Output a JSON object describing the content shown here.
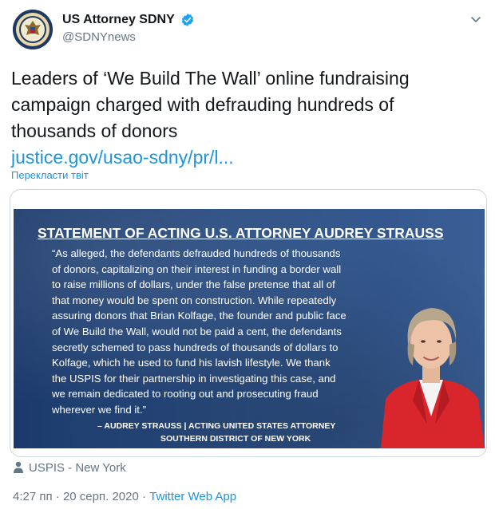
{
  "account": {
    "display_name": "US Attorney SDNY",
    "handle": "@SDNYnews",
    "verified": true
  },
  "tweet": {
    "text_lines": [
      "Leaders of ‘We Build The Wall’ online fundraising",
      "campaign charged with defrauding hundreds of",
      "thousands of donors"
    ],
    "link_text": "justice.gov/usao-sdny/pr/l...",
    "translate_label": "Перекласти твіт"
  },
  "image": {
    "title": "STATEMENT OF ACTING U.S. ATTORNEY AUDREY STRAUSS",
    "body_lines": [
      "“As alleged, the defendants defrauded hundreds of thousands",
      "of donors, capitalizing on their interest in funding a border wall",
      "to raise millions of dollars, under the false pretense that all of",
      "that money would be spent on construction.  While repeatedly",
      "assuring donors that Brian Kolfage, the founder and public face",
      "of We Build the Wall, would not be paid a cent, the defendants",
      "secretly schemed to pass hundreds of thousands of dollars to",
      "Kolfage, which he used to fund his lavish lifestyle.  We thank",
      "the USPIS for their partnership in investigating this case, and",
      "we remain dedicated to rooting out and prosecuting fraud",
      "wherever we find it.”"
    ],
    "signature_line1": "– AUDREY STRAUSS | ACTING UNITED STATES ATTORNEY",
    "signature_line2": "SOUTHERN DISTRICT OF NEW YORK"
  },
  "location": {
    "label": "USPIS - New York",
    "icon": "person-icon"
  },
  "meta": {
    "time": "4:27 пп",
    "separator": " · ",
    "date": "20 серп. 2020",
    "separator2": " · ",
    "app": "Twitter Web App"
  },
  "colors": {
    "link": "#1b95e0",
    "secondary_text": "#657786",
    "primary_text": "#14171a",
    "image_background": "#2a4d82",
    "verified_badge": "#1da1f2"
  }
}
